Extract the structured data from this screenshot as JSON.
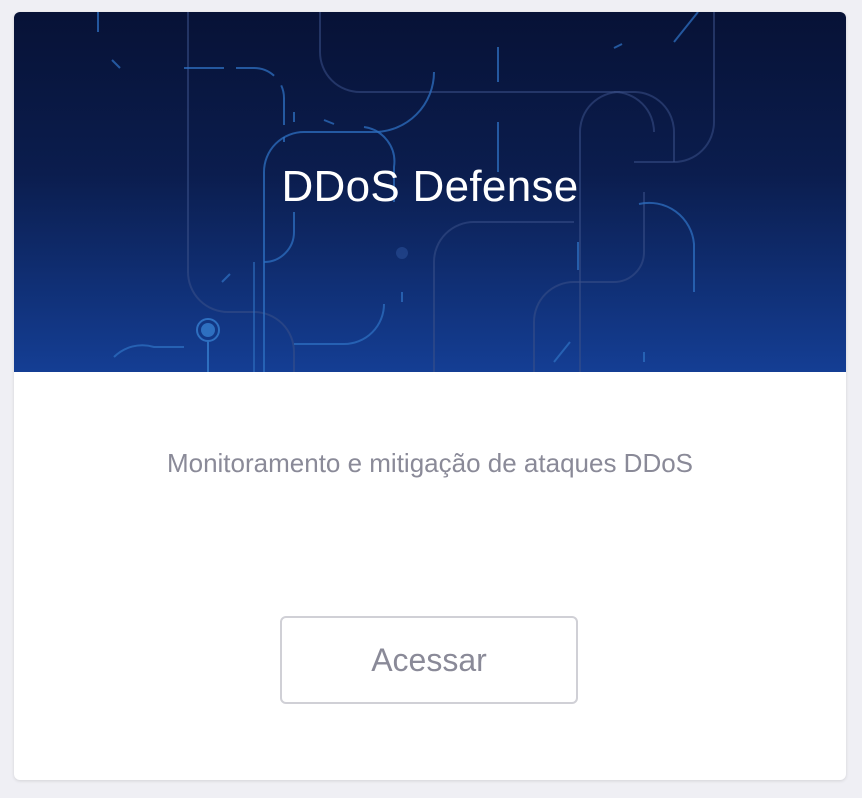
{
  "card": {
    "title": "DDoS Defense",
    "description": "Monitoramento e mitigação de ataques DDoS",
    "button_label": "Acessar",
    "hero_gradient": [
      "#071236",
      "#143e94"
    ],
    "title_color": "#ffffff",
    "text_color": "#8a8a98"
  }
}
